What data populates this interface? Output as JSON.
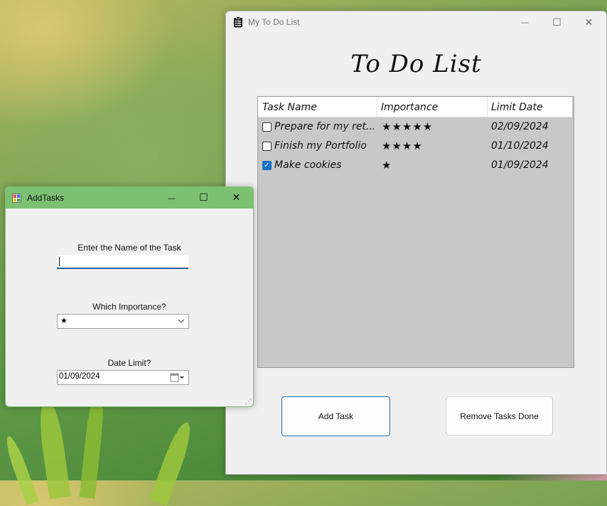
{
  "main_window": {
    "title": "My To Do List",
    "heading": "To Do List",
    "controls": {
      "minimize": "—",
      "maximize": "☐",
      "close": "✕"
    },
    "columns": [
      "Task Name",
      "Importance",
      "Limit Date"
    ],
    "tasks": [
      {
        "name": "Prepare for my ret...",
        "importance": "★★★★★",
        "date": "02/09/2024",
        "checked": false
      },
      {
        "name": "Finish my Portfolio",
        "importance": "★★★★",
        "date": "01/10/2024",
        "checked": false
      },
      {
        "name": "Make cookies",
        "importance": "★",
        "date": "01/09/2024",
        "checked": true
      }
    ],
    "add_button": "Add Task",
    "remove_button": "Remove Tasks Done"
  },
  "add_window": {
    "title": "AddTasks",
    "controls": {
      "minimize": "—",
      "maximize": "☐",
      "close": "✕"
    },
    "name_label": "Enter the Name of the Task",
    "name_value": "",
    "importance_label": "Which Importance?",
    "importance_value": "★",
    "date_label": "Date Limit?",
    "date_value": "01/09/2024"
  },
  "icons": {
    "main_title_icon": "clipboard-list-icon",
    "add_title_icon": "form-icon",
    "dropdown": "chevron-down-icon",
    "calendar": "calendar-icon",
    "checkbox_check": "checkmark-icon"
  }
}
